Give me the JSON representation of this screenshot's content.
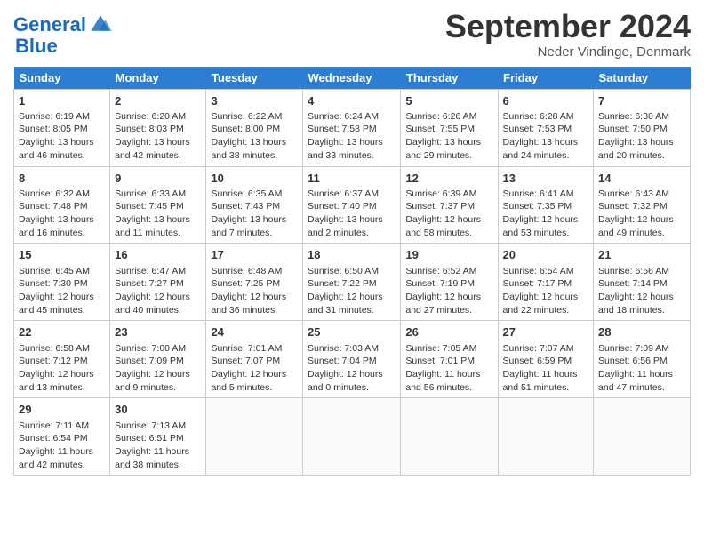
{
  "header": {
    "logo_line1": "General",
    "logo_line2": "Blue",
    "month_title": "September 2024",
    "location": "Neder Vindinge, Denmark"
  },
  "days_of_week": [
    "Sunday",
    "Monday",
    "Tuesday",
    "Wednesday",
    "Thursday",
    "Friday",
    "Saturday"
  ],
  "weeks": [
    [
      {
        "day": "1",
        "lines": [
          "Sunrise: 6:19 AM",
          "Sunset: 8:05 PM",
          "Daylight: 13 hours",
          "and 46 minutes."
        ]
      },
      {
        "day": "2",
        "lines": [
          "Sunrise: 6:20 AM",
          "Sunset: 8:03 PM",
          "Daylight: 13 hours",
          "and 42 minutes."
        ]
      },
      {
        "day": "3",
        "lines": [
          "Sunrise: 6:22 AM",
          "Sunset: 8:00 PM",
          "Daylight: 13 hours",
          "and 38 minutes."
        ]
      },
      {
        "day": "4",
        "lines": [
          "Sunrise: 6:24 AM",
          "Sunset: 7:58 PM",
          "Daylight: 13 hours",
          "and 33 minutes."
        ]
      },
      {
        "day": "5",
        "lines": [
          "Sunrise: 6:26 AM",
          "Sunset: 7:55 PM",
          "Daylight: 13 hours",
          "and 29 minutes."
        ]
      },
      {
        "day": "6",
        "lines": [
          "Sunrise: 6:28 AM",
          "Sunset: 7:53 PM",
          "Daylight: 13 hours",
          "and 24 minutes."
        ]
      },
      {
        "day": "7",
        "lines": [
          "Sunrise: 6:30 AM",
          "Sunset: 7:50 PM",
          "Daylight: 13 hours",
          "and 20 minutes."
        ]
      }
    ],
    [
      {
        "day": "8",
        "lines": [
          "Sunrise: 6:32 AM",
          "Sunset: 7:48 PM",
          "Daylight: 13 hours",
          "and 16 minutes."
        ]
      },
      {
        "day": "9",
        "lines": [
          "Sunrise: 6:33 AM",
          "Sunset: 7:45 PM",
          "Daylight: 13 hours",
          "and 11 minutes."
        ]
      },
      {
        "day": "10",
        "lines": [
          "Sunrise: 6:35 AM",
          "Sunset: 7:43 PM",
          "Daylight: 13 hours",
          "and 7 minutes."
        ]
      },
      {
        "day": "11",
        "lines": [
          "Sunrise: 6:37 AM",
          "Sunset: 7:40 PM",
          "Daylight: 13 hours",
          "and 2 minutes."
        ]
      },
      {
        "day": "12",
        "lines": [
          "Sunrise: 6:39 AM",
          "Sunset: 7:37 PM",
          "Daylight: 12 hours",
          "and 58 minutes."
        ]
      },
      {
        "day": "13",
        "lines": [
          "Sunrise: 6:41 AM",
          "Sunset: 7:35 PM",
          "Daylight: 12 hours",
          "and 53 minutes."
        ]
      },
      {
        "day": "14",
        "lines": [
          "Sunrise: 6:43 AM",
          "Sunset: 7:32 PM",
          "Daylight: 12 hours",
          "and 49 minutes."
        ]
      }
    ],
    [
      {
        "day": "15",
        "lines": [
          "Sunrise: 6:45 AM",
          "Sunset: 7:30 PM",
          "Daylight: 12 hours",
          "and 45 minutes."
        ]
      },
      {
        "day": "16",
        "lines": [
          "Sunrise: 6:47 AM",
          "Sunset: 7:27 PM",
          "Daylight: 12 hours",
          "and 40 minutes."
        ]
      },
      {
        "day": "17",
        "lines": [
          "Sunrise: 6:48 AM",
          "Sunset: 7:25 PM",
          "Daylight: 12 hours",
          "and 36 minutes."
        ]
      },
      {
        "day": "18",
        "lines": [
          "Sunrise: 6:50 AM",
          "Sunset: 7:22 PM",
          "Daylight: 12 hours",
          "and 31 minutes."
        ]
      },
      {
        "day": "19",
        "lines": [
          "Sunrise: 6:52 AM",
          "Sunset: 7:19 PM",
          "Daylight: 12 hours",
          "and 27 minutes."
        ]
      },
      {
        "day": "20",
        "lines": [
          "Sunrise: 6:54 AM",
          "Sunset: 7:17 PM",
          "Daylight: 12 hours",
          "and 22 minutes."
        ]
      },
      {
        "day": "21",
        "lines": [
          "Sunrise: 6:56 AM",
          "Sunset: 7:14 PM",
          "Daylight: 12 hours",
          "and 18 minutes."
        ]
      }
    ],
    [
      {
        "day": "22",
        "lines": [
          "Sunrise: 6:58 AM",
          "Sunset: 7:12 PM",
          "Daylight: 12 hours",
          "and 13 minutes."
        ]
      },
      {
        "day": "23",
        "lines": [
          "Sunrise: 7:00 AM",
          "Sunset: 7:09 PM",
          "Daylight: 12 hours",
          "and 9 minutes."
        ]
      },
      {
        "day": "24",
        "lines": [
          "Sunrise: 7:01 AM",
          "Sunset: 7:07 PM",
          "Daylight: 12 hours",
          "and 5 minutes."
        ]
      },
      {
        "day": "25",
        "lines": [
          "Sunrise: 7:03 AM",
          "Sunset: 7:04 PM",
          "Daylight: 12 hours",
          "and 0 minutes."
        ]
      },
      {
        "day": "26",
        "lines": [
          "Sunrise: 7:05 AM",
          "Sunset: 7:01 PM",
          "Daylight: 11 hours",
          "and 56 minutes."
        ]
      },
      {
        "day": "27",
        "lines": [
          "Sunrise: 7:07 AM",
          "Sunset: 6:59 PM",
          "Daylight: 11 hours",
          "and 51 minutes."
        ]
      },
      {
        "day": "28",
        "lines": [
          "Sunrise: 7:09 AM",
          "Sunset: 6:56 PM",
          "Daylight: 11 hours",
          "and 47 minutes."
        ]
      }
    ],
    [
      {
        "day": "29",
        "lines": [
          "Sunrise: 7:11 AM",
          "Sunset: 6:54 PM",
          "Daylight: 11 hours",
          "and 42 minutes."
        ]
      },
      {
        "day": "30",
        "lines": [
          "Sunrise: 7:13 AM",
          "Sunset: 6:51 PM",
          "Daylight: 11 hours",
          "and 38 minutes."
        ]
      },
      {
        "day": "",
        "lines": []
      },
      {
        "day": "",
        "lines": []
      },
      {
        "day": "",
        "lines": []
      },
      {
        "day": "",
        "lines": []
      },
      {
        "day": "",
        "lines": []
      }
    ]
  ]
}
